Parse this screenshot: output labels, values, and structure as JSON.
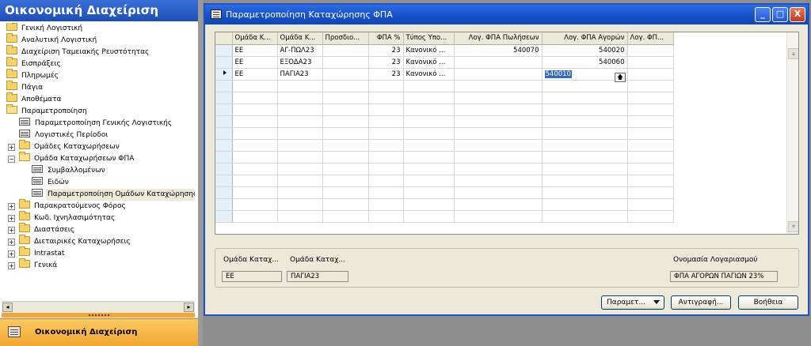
{
  "nav": {
    "title": "Οικονομική Διαχείριση",
    "bottom_label": "Οικονομική Διαχείριση",
    "tree": [
      {
        "label": "Γενική Λογιστική",
        "icon": "folder-icon"
      },
      {
        "label": "Αναλυτική Λογιστική",
        "icon": "folder-icon"
      },
      {
        "label": "Διαχείριση Ταμειακής Ρευστότητας",
        "icon": "folder-icon"
      },
      {
        "label": "Εισπράξεις",
        "icon": "folder-icon"
      },
      {
        "label": "Πληρωμές",
        "icon": "folder-icon"
      },
      {
        "label": "Πάγια",
        "icon": "folder-icon"
      },
      {
        "label": "Αποθέματα",
        "icon": "folder-icon"
      },
      {
        "label": "Παραμετροποίηση",
        "icon": "folder-open-icon"
      },
      {
        "label": "Παραμετροποίηση Γενικής Λογιστικής",
        "icon": "form-icon"
      },
      {
        "label": "Λογιστικές Περίοδοι",
        "icon": "form-icon"
      },
      {
        "label": "Ομάδες Καταχωρήσεων",
        "icon": "folder-icon"
      },
      {
        "label": "Ομάδα Καταχωρήσεων ΦΠΑ",
        "icon": "folder-open-icon"
      },
      {
        "label": "Συμβαλλομένων",
        "icon": "form-icon"
      },
      {
        "label": "Ειδών",
        "icon": "form-icon"
      },
      {
        "label": "Παραμετροποίηση Ομάδων Καταχώρησης",
        "icon": "form-icon"
      },
      {
        "label": "Παρακρατούμενος Φόρος",
        "icon": "folder-icon"
      },
      {
        "label": "Κωδ. Ιχνηλασιμότητας",
        "icon": "folder-icon"
      },
      {
        "label": "Διαστάσεις",
        "icon": "folder-icon"
      },
      {
        "label": "Διεταιρικές Καταχωρήσεις",
        "icon": "folder-icon"
      },
      {
        "label": "Intrastat",
        "icon": "folder-icon"
      },
      {
        "label": "Γενικά",
        "icon": "folder-icon"
      }
    ]
  },
  "window": {
    "title": "Παραμετροποίηση Καταχώρησης ΦΠΑ",
    "minimize": "_",
    "maximize": "□",
    "close": "X"
  },
  "grid": {
    "headers": [
      "Ομάδα Κ...",
      "Ομάδα Κ...",
      "Προσδιο...",
      "ΦΠΑ %",
      "Τύπος Υπο...",
      "Λογ. ΦΠΑ Πωλήσεων",
      "Λογ. ΦΠΑ Αγορών",
      "Λογ. ΦΠ..."
    ],
    "rows": [
      [
        "ΕΕ",
        "ΑΓ-ΠΩΛ23",
        "",
        "23",
        "Κανονικό ...",
        "540070",
        "540020",
        ""
      ],
      [
        "ΕΕ",
        "ΕΞΟΔΑ23",
        "",
        "23",
        "Κανονικό ...",
        "",
        "540060",
        ""
      ],
      [
        "ΕΕ",
        "ΠΑΓΙΑ23",
        "",
        "23",
        "Κανονικό ...",
        "",
        "540010",
        ""
      ]
    ],
    "current_row": 3,
    "empty_rows": 12
  },
  "info": {
    "label1": "Ομάδα Καταχ...",
    "value1": "ΕΕ",
    "label2": "Ομάδα Καταχ...",
    "value2": "ΠΑΓΙΑ23",
    "label3": "Ονομασία Λογαριασμού",
    "value3": "ΦΠΑ  ΑΓΟΡΩΝ ΠΑΓΙΩΝ 23%"
  },
  "buttons": {
    "setup": "Παραμετ...",
    "copy": "Αντιγραφή...",
    "help": "Βοήθεια"
  }
}
